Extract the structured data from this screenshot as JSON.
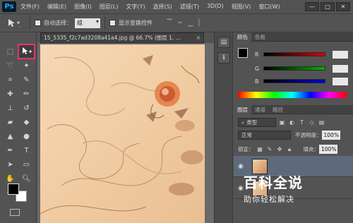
{
  "app": {
    "logo": "Ps"
  },
  "menubar": {
    "items": [
      "文件(F)",
      "编辑(E)",
      "图像(I)",
      "图层(L)",
      "文字(Y)",
      "选择(S)",
      "滤镜(T)",
      "3D(D)",
      "视图(V)",
      "窗口(W)"
    ],
    "window_buttons": [
      "—",
      "□",
      "✕"
    ]
  },
  "options": {
    "auto_select_label": "自动选择：",
    "auto_select_value": "组",
    "show_transform_label": "显示变换控件"
  },
  "document": {
    "tab_title": "15_5335_f2c7ad3208a41a4.jpg @ 66.7% (图层 1, ...",
    "close_glyph": "×"
  },
  "color_panel": {
    "tabs": [
      "颜色",
      "色板"
    ],
    "sliders": [
      {
        "label": "R",
        "value": ""
      },
      {
        "label": "G",
        "value": ""
      },
      {
        "label": "B",
        "value": ""
      }
    ],
    "colors": {
      "red": "#e00000",
      "green": "#00b400",
      "blue": "#0000e0"
    }
  },
  "layers_panel": {
    "tabs": [
      "图层",
      "通道",
      "路径"
    ],
    "filter_label": "类型",
    "blend_mode": "正常",
    "opacity_label": "不透明度：",
    "opacity_value": "100%",
    "lock_label": "锁定：",
    "fill_label": "填充：",
    "fill_value": "100%",
    "layers": [
      {
        "name": "",
        "selected": true
      },
      {
        "name": "",
        "selected": false
      }
    ]
  },
  "watermark": {
    "title": "百科全说",
    "subtitle": "助你轻松解决"
  },
  "accent_colors": {
    "highlight": "#e8336d",
    "ps_blue": "#31a8ff"
  }
}
